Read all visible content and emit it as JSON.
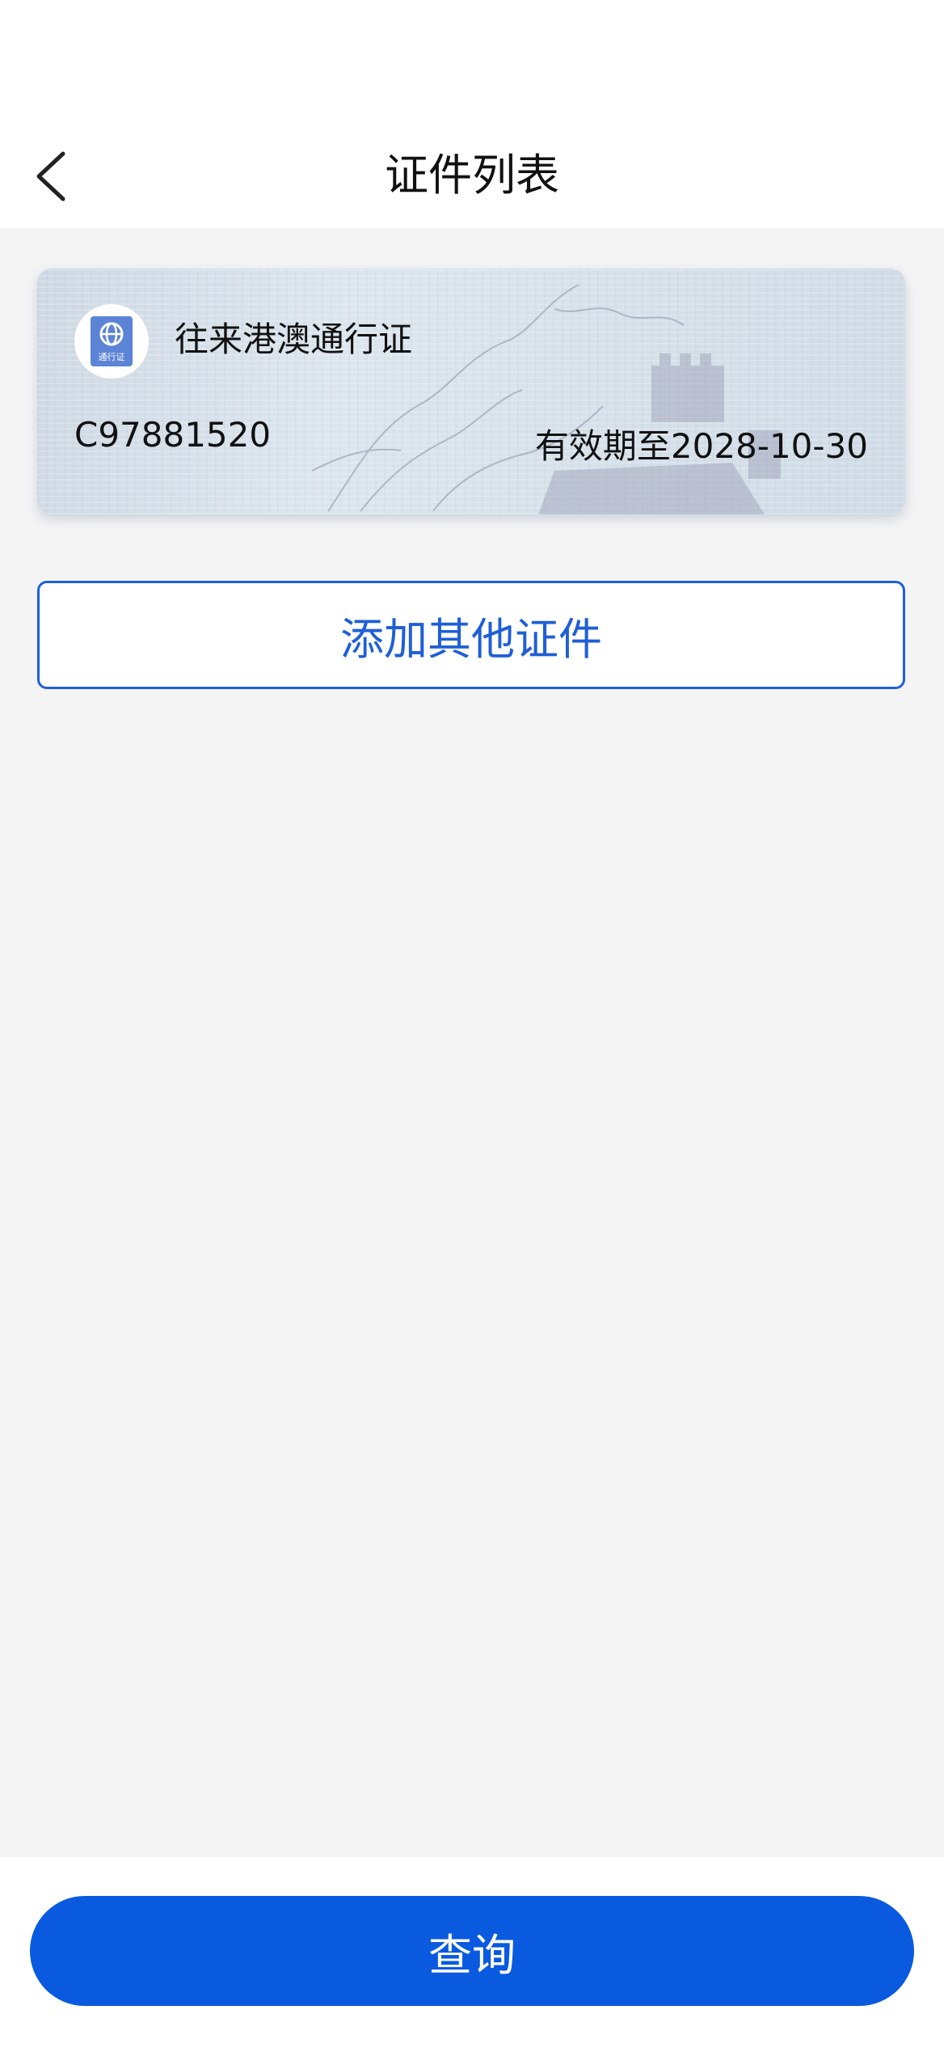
{
  "header": {
    "title": "证件列表",
    "back_icon": "chevron-left-icon"
  },
  "documents": [
    {
      "name": "往来港澳通行证",
      "logo_icon": "permit-book-icon",
      "logo_text": "通行证",
      "number": "C97881520",
      "expiry": "有效期至2028-10-30"
    }
  ],
  "actions": {
    "add_label": "添加其他证件",
    "query_label": "查询"
  },
  "colors": {
    "accent": "#0a5ae0",
    "outline": "#1f5fd6",
    "background": "#f4f4f5"
  }
}
